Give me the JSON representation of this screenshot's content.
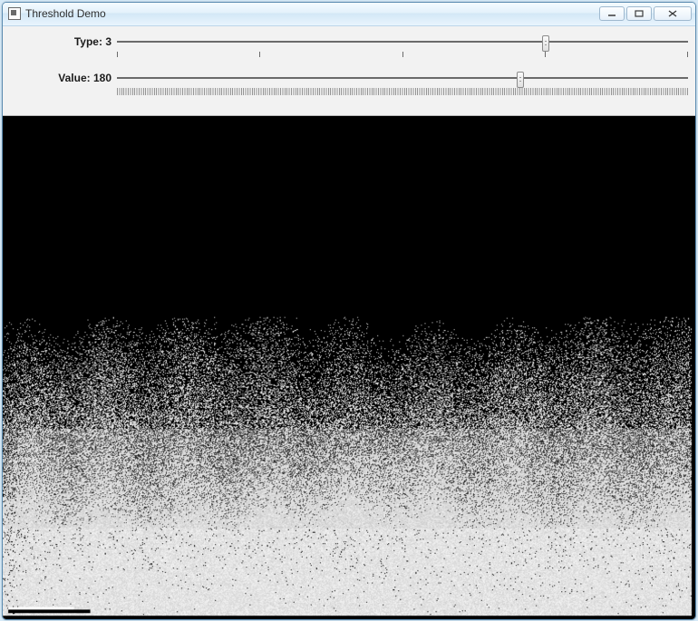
{
  "window": {
    "title": "Threshold Demo"
  },
  "controls": {
    "type": {
      "label": "Type:",
      "value": 3,
      "min": 0,
      "max": 4
    },
    "value": {
      "label": "Value:",
      "value": 180,
      "min": 0,
      "max": 255
    }
  }
}
